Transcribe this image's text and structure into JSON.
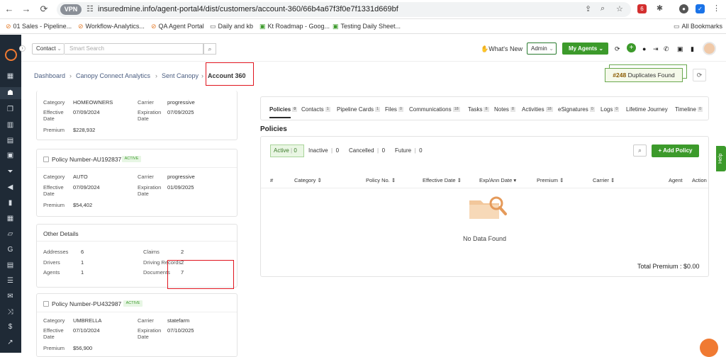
{
  "browser": {
    "vpn_label": "VPN",
    "url": "insuredmine.info/agent-portal4/dist/customers/account-360/66b4a67f3f0e7f1331d669bf",
    "ext_badge": "6"
  },
  "bookmarks": {
    "items": [
      "01 Sales - Pipeline...",
      "Workflow-Analytics...",
      "QA Agent Portal",
      "Daily and kb",
      "Kt Roadmap - Goog...",
      "Testing Daily Sheet..."
    ],
    "all_label": "All Bookmarks"
  },
  "topbar": {
    "contact_select": "Contact",
    "search_placeholder": "Smart Search",
    "whats_new": "What's New",
    "admin_select": "Admin",
    "my_agents": "My Agents"
  },
  "breadcrumb": {
    "items": [
      "Dashboard",
      "Canopy Connect Analytics",
      "Sent Canopy"
    ],
    "current": "Account 360"
  },
  "duplicates": {
    "count": "#248",
    "label": "Duplicates Found"
  },
  "policy_cards": [
    {
      "category_label": "Category",
      "category": "HOMEOWNERS",
      "carrier_label": "Carrier",
      "carrier": "progressive",
      "effective_label": "Effective Date",
      "effective": "07/09/2024",
      "expiration_label": "Expiration Date",
      "expiration": "07/09/2025",
      "premium_label": "Premium",
      "premium": "$228,932"
    },
    {
      "title": "Policy Number-AU192837",
      "badge": "ACTIVE",
      "category_label": "Category",
      "category": "AUTO",
      "carrier_label": "Carrier",
      "carrier": "progressive",
      "effective_label": "Effective Date",
      "effective": "07/09/2024",
      "expiration_label": "Expiration Date",
      "expiration": "01/09/2025",
      "premium_label": "Premium",
      "premium": "$54,402"
    },
    {
      "title": "Policy Number-PU432987",
      "badge": "ACTIVE",
      "category_label": "Category",
      "category": "UMBRELLA",
      "carrier_label": "Carrier",
      "carrier": "statefarm",
      "effective_label": "Effective Date",
      "effective": "07/10/2024",
      "expiration_label": "Expiration Date",
      "expiration": "07/10/2025",
      "premium_label": "Premium",
      "premium": "$56,900"
    }
  ],
  "other_details": {
    "title": "Other Details",
    "addresses_label": "Addresses",
    "addresses": "6",
    "drivers_label": "Drivers",
    "drivers": "1",
    "agents_label": "Agents",
    "agents": "1",
    "claims_label": "Claims",
    "claims": "2",
    "driving_label": "Driving Records",
    "driving": "2",
    "documents_label": "Documents",
    "documents": "7"
  },
  "tabs": [
    {
      "label": "Policies",
      "count": "0"
    },
    {
      "label": "Contacts",
      "count": "1"
    },
    {
      "label": "Pipeline Cards",
      "count": "1"
    },
    {
      "label": "Files",
      "count": "0"
    },
    {
      "label": "Communications",
      "count": "18"
    },
    {
      "label": "Tasks",
      "count": "8"
    },
    {
      "label": "Notes",
      "count": "8"
    },
    {
      "label": "Activities",
      "count": "18"
    },
    {
      "label": "eSignatures",
      "count": "0"
    },
    {
      "label": "Logs",
      "count": "0"
    },
    {
      "label": "Lifetime Journey",
      "count": ""
    },
    {
      "label": "Timeline",
      "count": "0"
    }
  ],
  "policies": {
    "heading": "Policies",
    "filters": [
      {
        "label": "Active",
        "count": "0"
      },
      {
        "label": "Inactive",
        "count": "0"
      },
      {
        "label": "Cancelled",
        "count": "0"
      },
      {
        "label": "Future",
        "count": "0"
      }
    ],
    "add_button": "Add Policy",
    "columns": [
      "#",
      "Category",
      "Policy No.",
      "Effective Date",
      "Exp/Ann Date",
      "Premium",
      "Carrier",
      "Agent",
      "Action"
    ],
    "empty_text": "No Data Found",
    "total_label": "Total Premium : $0.00"
  },
  "help_label": "Help",
  "colors": {
    "brand_green": "#3c9a2b",
    "brand_orange": "#f07a32",
    "sidebar": "#1f2a36",
    "highlight_red": "#e0141e"
  }
}
